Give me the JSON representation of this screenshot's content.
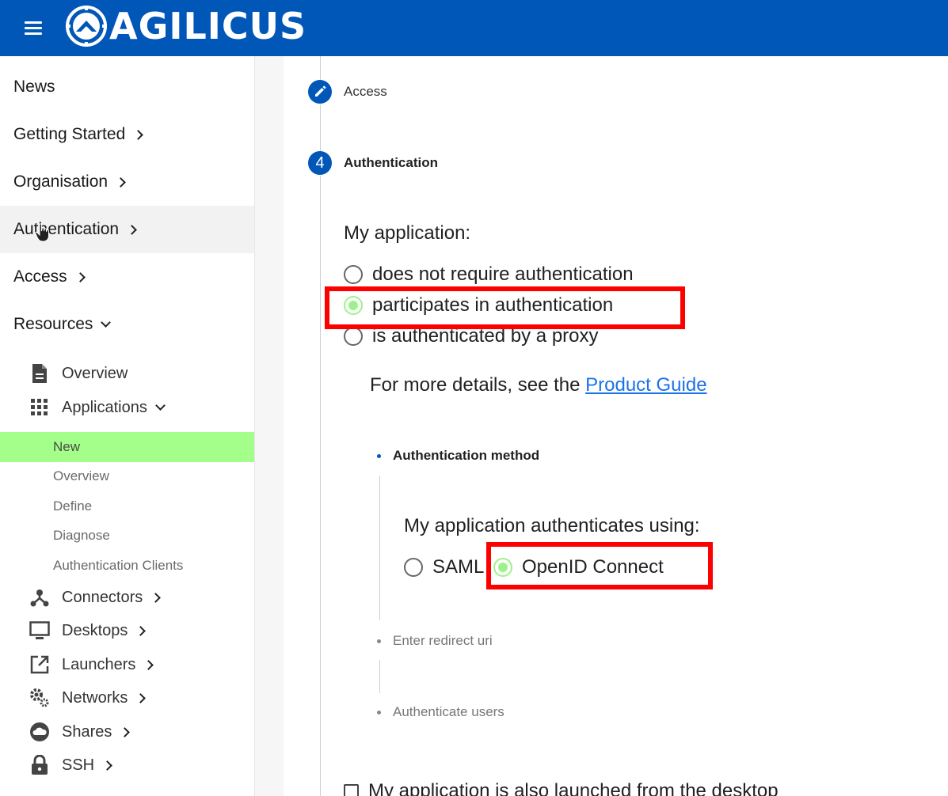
{
  "header": {
    "brand": "AGILICUS",
    "colors": {
      "bar": "#0057b8"
    }
  },
  "sidebar": {
    "top_items": [
      {
        "label": "News"
      },
      {
        "label": "Getting Started"
      },
      {
        "label": "Organisation"
      },
      {
        "label": "Authentication"
      },
      {
        "label": "Access"
      },
      {
        "label": "Resources"
      }
    ],
    "resources": {
      "overview": "Overview",
      "applications": "Applications",
      "applications_children": [
        "New",
        "Overview",
        "Define",
        "Diagnose",
        "Authentication Clients"
      ],
      "connectors": "Connectors",
      "desktops": "Desktops",
      "launchers": "Launchers",
      "networks": "Networks",
      "shares": "Shares",
      "ssh": "SSH"
    },
    "selected_color": "#a3ff8a"
  },
  "stepper": {
    "steps": [
      {
        "label": "Access",
        "icon": "pencil-icon"
      },
      {
        "number": "4",
        "label": "Authentication"
      }
    ]
  },
  "auth": {
    "question": "My application:",
    "options": [
      "does not require authentication",
      "participates in authentication",
      "is authenticated by a proxy"
    ],
    "selected": "participates in authentication",
    "info_prefix": "For more details, see the",
    "info_link": "Product Guide",
    "substeps": [
      "Authentication method",
      "Enter redirect uri",
      "Authenticate users"
    ],
    "method_question": "My application authenticates using:",
    "methods": [
      "SAML",
      "OpenID Connect"
    ],
    "selected_method": "OpenID Connect",
    "desktop_checkbox": "My application is also launched from the desktop"
  }
}
